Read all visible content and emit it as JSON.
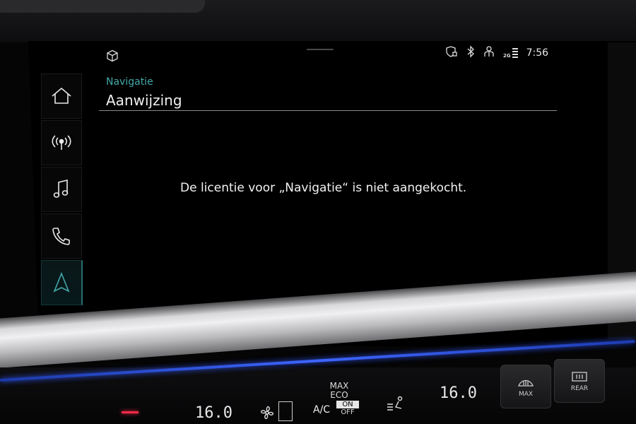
{
  "status_bar": {
    "clock": "7:56",
    "network": "2G",
    "icons": [
      "cube-icon",
      "shield-lock-icon",
      "bluetooth-icon",
      "user-icon",
      "signal-icon"
    ]
  },
  "sidebar": {
    "items": [
      {
        "name": "home",
        "icon": "home-icon"
      },
      {
        "name": "radio",
        "icon": "radio-icon"
      },
      {
        "name": "media",
        "icon": "music-note-icon"
      },
      {
        "name": "phone",
        "icon": "phone-icon"
      },
      {
        "name": "navigation",
        "icon": "navigation-arrow-icon",
        "active": true
      }
    ]
  },
  "header": {
    "section": "Navigatie",
    "title": "Aanwijzing"
  },
  "main": {
    "message": "De licentie voor „Navigatie“ is niet aangekocht."
  },
  "climate": {
    "temp_left": "16.0",
    "temp_right": "16.0",
    "max_label": "MAX",
    "eco_label": "ECO",
    "ac_label": "A/C",
    "on_label": "ON",
    "off_label": "OFF",
    "defrost_max_label": "MAX",
    "rear_label": "REAR"
  },
  "colors": {
    "accent": "#43a9aa",
    "background": "#000000",
    "text": "#f0f0f0"
  }
}
